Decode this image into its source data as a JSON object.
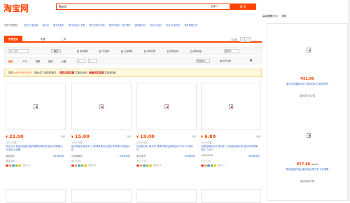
{
  "header": {
    "logo_text": "淘宝网",
    "search_value": "贴纱灯",
    "scope_label": "全部",
    "search_button": "搜 索",
    "top_links": [
      "高级搜索",
      "帮助"
    ]
  },
  "hot_suggest": {
    "label": "你是不是想找：",
    "items": [
      "贴纱灯 免运费",
      "贴纱灯",
      "紫光灯贴纱",
      "紫光灯贴纱 手笔",
      "紫光灯贴纱手笔",
      "紫光灯贴纱 小型 便携",
      "迷你贴纱灯",
      "贴纱灯 贴纱",
      "贴纱灯 紫光灯",
      "紫外线贴纱灯"
    ]
  },
  "tabs": {
    "all": "所有宝贝",
    "tmall": "天猫",
    "second_hand": "二手",
    "page_info": "1/100",
    "prev": "‹",
    "next": "›"
  },
  "filters": {
    "brand_placeholder": "降价",
    "brand_hint": "品牌",
    "confirm": "确定",
    "free_shipping": "免费邮费",
    "seven_day_return": "7天退换",
    "genuine": "正品保障",
    "installment": "折扣优惠",
    "consumer_guarantee": "旺旺在线",
    "overseas": "海外商品",
    "style_label": "新款",
    "sort": [
      "综合",
      "人气",
      "销量",
      "信用",
      "价格"
    ],
    "price_from": "¥",
    "price_to": "¥",
    "location": "所在地",
    "display_toggle": "显示全部"
  },
  "notice": {
    "prefix": "您好",
    "user": "cu003000003",
    "middle": "，“贴纱灯” 相关的宝贝：",
    "strong1": "购买过的店铺",
    "suffix1": "共找到0家",
    "sep": "|",
    "strong2": "收藏过的店铺",
    "suffix2": "共找到0家"
  },
  "products": [
    {
      "price": "21.00",
      "tag": "包邮",
      "buyers": "382人付款",
      "title": "专业日口卡贴纱机紫光迷你便携式紫光灯贴纱手笔紫光灯 贴纱手电筒",
      "shop": "诚善优品",
      "reviews": "653条评论",
      "loc": "福建 福州",
      "city_r": "",
      "labels": [
        "天猫",
        "4.8"
      ]
    },
    {
      "price": "15.00",
      "tag": "包邮",
      "buyers": "145人付款",
      "title": "贴纱机贴纱紫光灯 小型便携紫光灯贴纱手电筒 灯泡贴纱机",
      "shop": "百信旗舰店",
      "reviews": "185条评论",
      "loc": "浙江 温州",
      "city_r": "",
      "labels": [
        "天猫",
        "4.9"
      ]
    },
    {
      "price": "19.00",
      "tag": "包邮",
      "buyers": "219人付款",
      "title": "正品贴纱灯 紫光灯 便携式紫光迷你贴纱灯 DL-01贴纱灯",
      "shop": "紫光百货",
      "reviews": "326条评论",
      "loc": "浙江 义乌",
      "city_r": "",
      "labels": [
        "淘宝",
        "4.8"
      ]
    },
    {
      "price": "6.80",
      "tag": "包邮",
      "buyers": "819人付款",
      "title": "全国包邮贴纱灯 紫光灯 小型迷你贴纱机 贴纱机专用紫光灯 三合一",
      "shop": "lu0000000",
      "reviews": "685条评论",
      "loc": "广东 广州",
      "city_r": "",
      "labels": [
        "淘宝",
        "4.7"
      ]
    }
  ],
  "sidebar": {
    "title": "掌柜热卖",
    "items": [
      {
        "price": "21.00",
        "orig": "",
        "title": "紫光手电筒贴纱灯 迷你贴纱灯 紫光防伪",
        "sold": "最近成交552笔"
      },
      {
        "price": "27.80",
        "orig": "39.00",
        "title": "防伪检测灯贴纱紫光贴纱笔子灯 5手电筒",
        "sold": "最近成交61笔"
      }
    ]
  }
}
